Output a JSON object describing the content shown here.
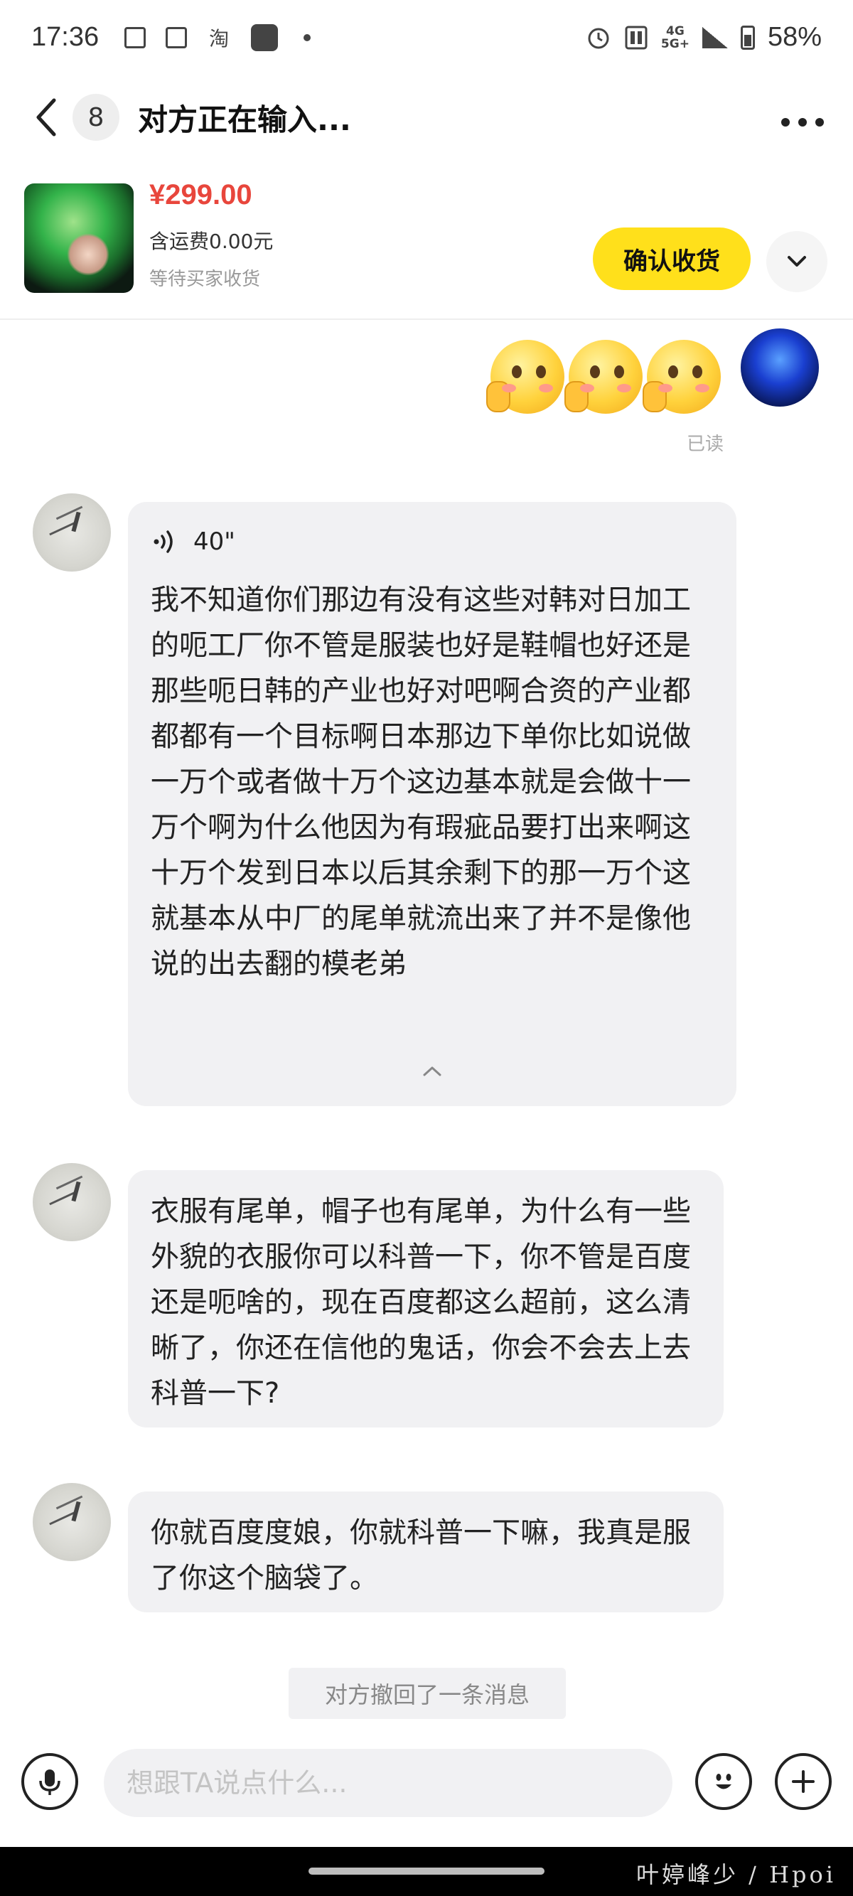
{
  "status_bar": {
    "time": "17:36",
    "app_icon": "淘",
    "network_top": "4G",
    "network_bottom": "5G+",
    "battery": "58%"
  },
  "header": {
    "unread_count": "8",
    "title": "对方正在输入..."
  },
  "product": {
    "price": "¥299.00",
    "shipping": "含运费0.00元",
    "status": "等待买家收货",
    "confirm_label": "确认收货"
  },
  "messages": {
    "read_label": "已读",
    "voice_duration": "40\"",
    "voice_text": "我不知道你们那边有没有这些对韩对日加工的呃工厂你不管是服装也好是鞋帽也好还是那些呃日韩的产业也好对吧啊合资的产业都都都有一个目标啊日本那边下单你比如说做一万个或者做十万个这边基本就是会做十一万个啊为什么他因为有瑕疵品要打出来啊这十万个发到日本以后其余剩下的那一万个这就基本从中厂的尾单就流出来了并不是像他说的出去翻的模老弟",
    "collapse_glyph": "⌃",
    "text_1": "衣服有尾单，帽子也有尾单，为什么有一些外貌的衣服你可以科普一下，你不管是百度还是呃啥的，现在百度都这么超前，这么清晰了，你还在信他的鬼话，你会不会去上去科普一下?",
    "text_2": "你就百度度娘，你就科普一下嘛，我真是服了你这个脑袋了。",
    "recall_notice": "对方撤回了一条消息"
  },
  "input": {
    "placeholder": "想跟TA说点什么..."
  },
  "watermark": "叶婷峰少 / Hpoi",
  "icons": {
    "back": "chevron-left-icon",
    "more": "more-horizontal-icon",
    "expand": "chevron-down-icon",
    "voice_wave": "voice-wave-icon",
    "mic": "microphone-icon",
    "emoji": "smiley-icon",
    "plus": "plus-icon"
  },
  "colors": {
    "accent_yellow": "#ffe01b",
    "price_red": "#e8463c",
    "bubble_gray": "#f1f1f3"
  }
}
